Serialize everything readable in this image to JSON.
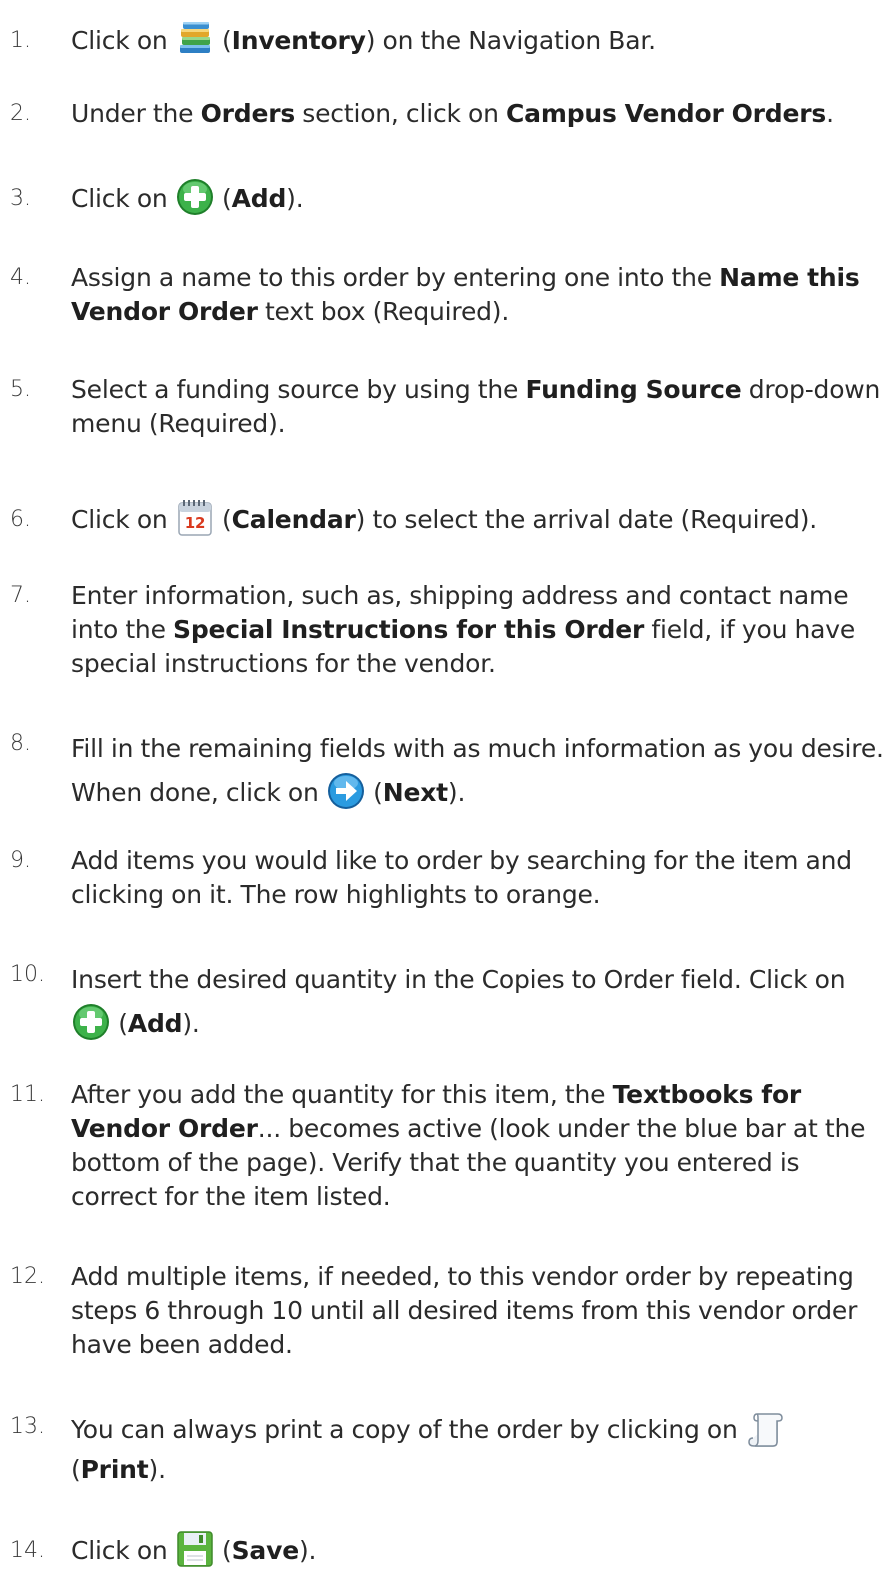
{
  "steps": [
    {
      "num": "1.",
      "t1": "Click on ",
      "t2": " (",
      "b1": "Inventory",
      "t3": ") on the Navigation Bar.",
      "icon": "inventory-books-icon"
    },
    {
      "num": "2.",
      "t1": "Under the ",
      "b1": "Orders",
      "t2": " section, click on ",
      "b2": "Campus Vendor Orders",
      "t3": "."
    },
    {
      "num": "3.",
      "t1": "Click on ",
      "t2": " (",
      "b1": "Add",
      "t3": ").",
      "icon": "add-plus-icon"
    },
    {
      "num": "4.",
      "t1": "Assign a name to this order by entering one into the ",
      "b1": "Name this Vendor Order",
      "t2": " text box (Required)."
    },
    {
      "num": "5.",
      "t1": "Select a funding source by using the ",
      "b1": "Funding Source",
      "t2": " drop-down menu (Required)."
    },
    {
      "num": "6.",
      "t1": "Click on ",
      "t2": " (",
      "b1": "Calendar",
      "t3": ") to select the arrival date (Required).",
      "icon": "calendar-icon",
      "icon_text": "12"
    },
    {
      "num": "7.",
      "t1": "Enter information, such as, shipping address and contact name into the ",
      "b1": "Special Instructions for this Order",
      "t2": " field, if you have special instructions for the vendor."
    },
    {
      "num": "8.",
      "t1": "Fill in the remaining fields with as much information as you desire. When done, click on ",
      "t2": " (",
      "b1": "Next",
      "t3": ").",
      "icon": "next-arrow-icon"
    },
    {
      "num": "9.",
      "t1": "Add items you would like to order by searching for the item and clicking on it. The row highlights to orange."
    },
    {
      "num": "10.",
      "t1": "Insert the desired quantity in the Copies to Order field. Click on ",
      "t2": " (",
      "b1": "Add",
      "t3": ").",
      "icon": "add-plus-icon"
    },
    {
      "num": "11.",
      "t1": "After you add the quantity for this item, the ",
      "b1": "Textbooks for Vendor Order",
      "t2": "... becomes active (look under the blue bar at the bottom of the page). Verify that the quantity you entered is correct for the item listed."
    },
    {
      "num": "12.",
      "t1": "Add multiple items, if needed, to this vendor order by repeating steps 6 through 10 until all desired items from this vendor order have been added."
    },
    {
      "num": "13.",
      "t1": "You can always print a copy of the order by clicking on ",
      "t2": " (",
      "b1": "Print",
      "t3": ").",
      "icon": "print-scroll-icon"
    },
    {
      "num": "14.",
      "t1": "Click on ",
      "t2": " (",
      "b1": "Save",
      "t3": ").",
      "icon": "save-disk-icon"
    }
  ],
  "colors": {
    "text": "#2b2b2b",
    "add_green": "#2fa33a",
    "next_blue": "#1e8fd6",
    "calendar_red": "#d9391e",
    "save_green": "#6cc04a"
  }
}
